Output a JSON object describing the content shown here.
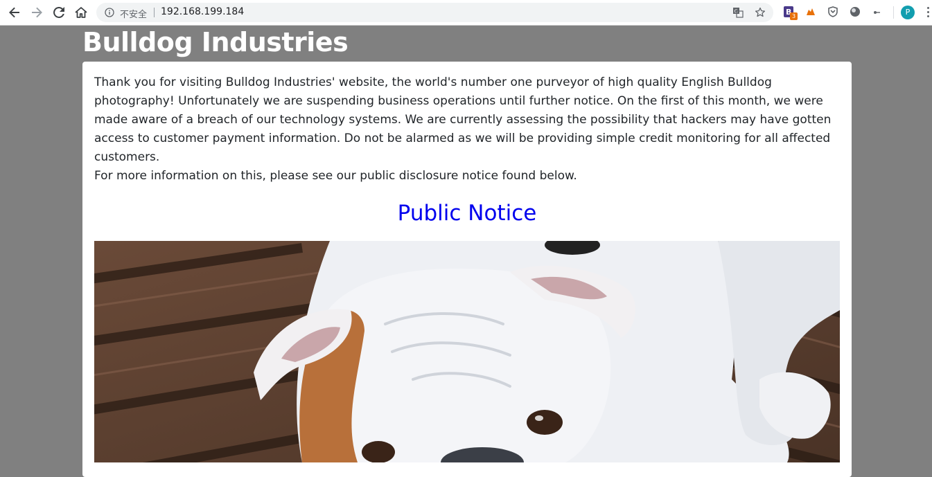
{
  "browser": {
    "security_label": "不安全",
    "url": "192.168.199.184",
    "extension_badge": "3",
    "profile_initial": "P"
  },
  "icons": {
    "back": "back-arrow-icon",
    "forward": "forward-arrow-icon",
    "reload": "reload-icon",
    "home": "home-icon",
    "info": "info-icon",
    "translate": "translate-icon",
    "bookmark": "star-icon",
    "menu": "more-vert-icon"
  },
  "page": {
    "title": "Bulldog Industries",
    "intro": "Thank you for visiting Bulldog Industries' website, the world's number one purveyor of high quality English Bulldog photography! Unfortunately we are suspending business operations until further notice. On the first of this month, we were made aware of a breach of our technology systems. We are currently assessing the possibility that hackers may have gotten access to customer payment information. Do not be alarmed as we will be providing simple credit monitoring for all affected customers.",
    "more_info": "For more information on this, please see our public disclosure notice found below.",
    "notice_link": "Public Notice",
    "photo_alt": "English Bulldog photograph"
  },
  "colors": {
    "page_background": "#808080",
    "link": "#0000ee",
    "body_text": "#212529"
  }
}
